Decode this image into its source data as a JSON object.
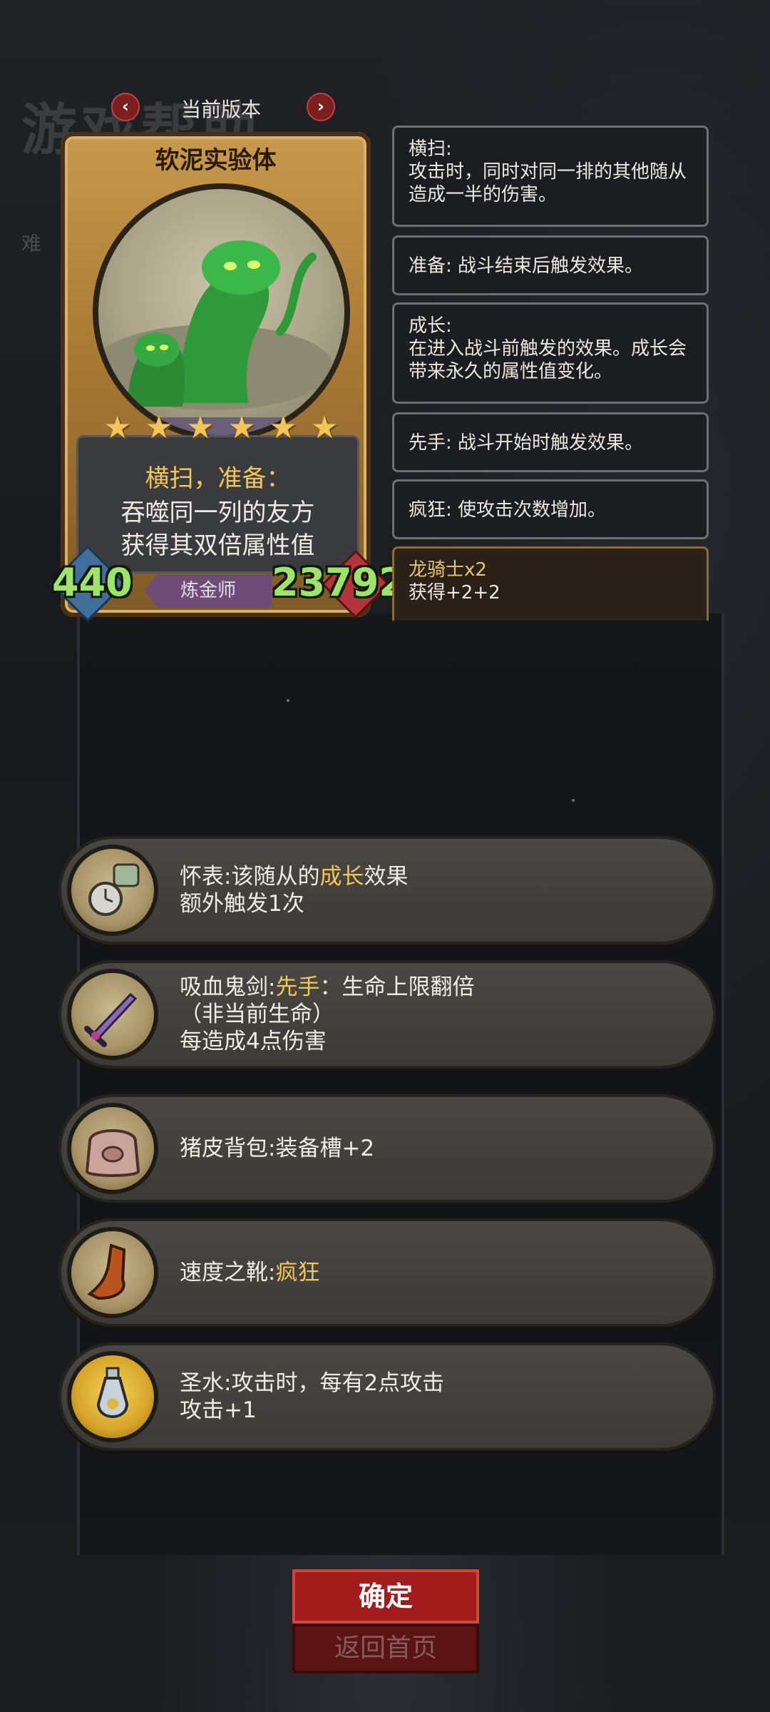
{
  "background": {
    "ghost_title": "游戏帮助",
    "ghost_side": "难"
  },
  "version_bar": {
    "prev_icon": "chevron-left-icon",
    "next_icon": "chevron-right-icon",
    "label": "当前版本"
  },
  "card": {
    "name": "软泥实验体",
    "stars": 6,
    "ability_keywords": "横扫，准备：",
    "ability_line1": "吞噬同一列的友方",
    "ability_line2": "获得其双倍属性值",
    "attack": "440",
    "health": "23792",
    "class": "炼金师",
    "colors": {
      "frame": "#c89a4e",
      "stat": "#9fe36a",
      "class_tag": "#6d4d78",
      "star": "#f2c55a"
    }
  },
  "glossary": [
    {
      "title": "横扫:",
      "body": [
        "攻击时，同时对同一排的其他随从",
        "造成一半的伤害。"
      ]
    },
    {
      "title": "准备: 战斗结束后触发效果。",
      "body": []
    },
    {
      "title": "成长:",
      "body": [
        "在进入战斗前触发的效果。成长会",
        "带来永久的属性值变化。"
      ]
    },
    {
      "title": "先手: 战斗开始时触发效果。",
      "body": []
    },
    {
      "title": "疯狂: 使攻击次数增加。",
      "body": []
    },
    {
      "title": "龙骑士x2",
      "body": [
        "获得+2+2"
      ]
    }
  ],
  "items": [
    {
      "icon": "pocket-watch-icon",
      "name": "怀表:",
      "pre": "该随从的",
      "kw": "成长",
      "post": "效果",
      "line2": "额外触发1次",
      "line3": ""
    },
    {
      "icon": "vampire-sword-icon",
      "name": "吸血鬼剑:",
      "pre": "",
      "kw": "先手",
      "post": "：生命上限翻倍",
      "line2": "（非当前生命）",
      "line3": "每造成4点伤害"
    },
    {
      "icon": "pigskin-backpack-icon",
      "name": "猪皮背包:",
      "pre": "装备槽+2",
      "kw": "",
      "post": "",
      "line2": "",
      "line3": ""
    },
    {
      "icon": "speed-boots-icon",
      "name": "速度之靴:",
      "pre": "",
      "kw": "疯狂",
      "post": "",
      "line2": "",
      "line3": ""
    },
    {
      "icon": "holy-water-icon",
      "name": "圣水:",
      "pre": "攻击时，每有2点攻击",
      "kw": "",
      "post": "",
      "line2": "攻击+1",
      "line3": ""
    }
  ],
  "buttons": {
    "confirm": "确定",
    "home": "返回首页"
  }
}
